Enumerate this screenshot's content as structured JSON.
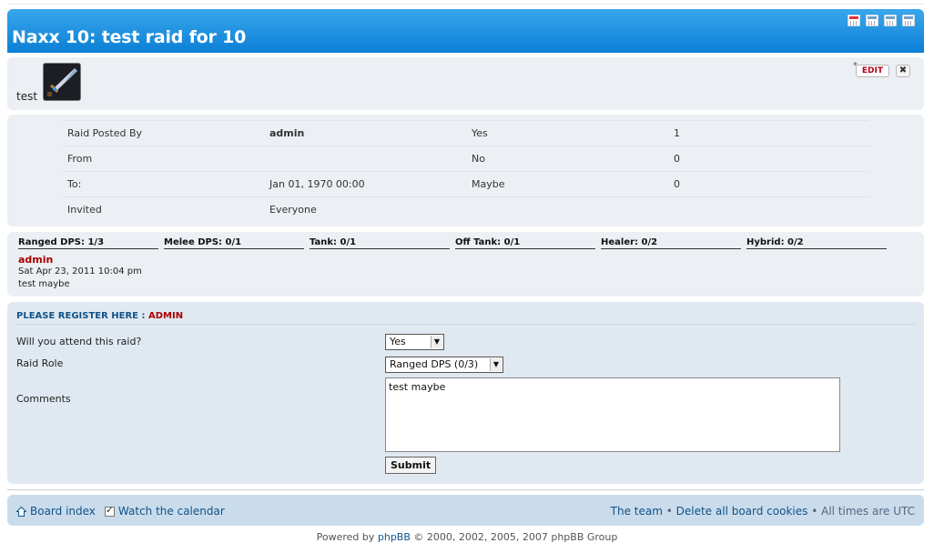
{
  "header": {
    "title": "Naxx 10: test raid for 10",
    "icons": [
      "calendar-add-icon",
      "calendar-day-icon",
      "calendar-week-icon",
      "calendar-month-icon"
    ]
  },
  "event": {
    "name": "test",
    "avatar_icon": "sword-icon",
    "edit_label": "EDIT",
    "delete_label": "✖",
    "edit_star": "*"
  },
  "info": {
    "rows": [
      {
        "label": "Raid Posted By",
        "value": "admin",
        "stat_label": "Yes",
        "stat_value": "1"
      },
      {
        "label": "From",
        "value": "",
        "stat_label": "No",
        "stat_value": "0"
      },
      {
        "label": "To:",
        "value": "Jan 01, 1970 00:00",
        "stat_label": "Maybe",
        "stat_value": "0"
      },
      {
        "label": "Invited",
        "value": "Everyone",
        "stat_label": "",
        "stat_value": ""
      }
    ]
  },
  "roles": {
    "items": [
      "Ranged DPS: 1/3",
      "Melee DPS: 0/1",
      "Tank: 0/1",
      "Off Tank: 0/1",
      "Healer: 0/2",
      "Hybrid: 0/2"
    ]
  },
  "signup": {
    "user": "admin",
    "date": "Sat Apr 23, 2011 10:04 pm",
    "comment": "test maybe"
  },
  "register": {
    "title": "PLEASE REGISTER HERE : ",
    "user": "ADMIN",
    "attend_label": "Will you attend this raid?",
    "attend_value": "Yes",
    "role_label": "Raid Role",
    "role_value": "Ranged DPS (0/3)",
    "comments_label": "Comments",
    "comments_value": "test maybe",
    "submit_label": "Submit"
  },
  "footer": {
    "board_index": "Board index",
    "watch": "Watch the calendar",
    "team": "The team",
    "delete_cookies": "Delete all board cookies",
    "times": "All times are UTC",
    "bullet": " • "
  },
  "powered": {
    "prefix": "Powered by ",
    "link": "phpBB",
    "suffix": " © 2000, 2002, 2005, 2007 phpBB Group"
  }
}
